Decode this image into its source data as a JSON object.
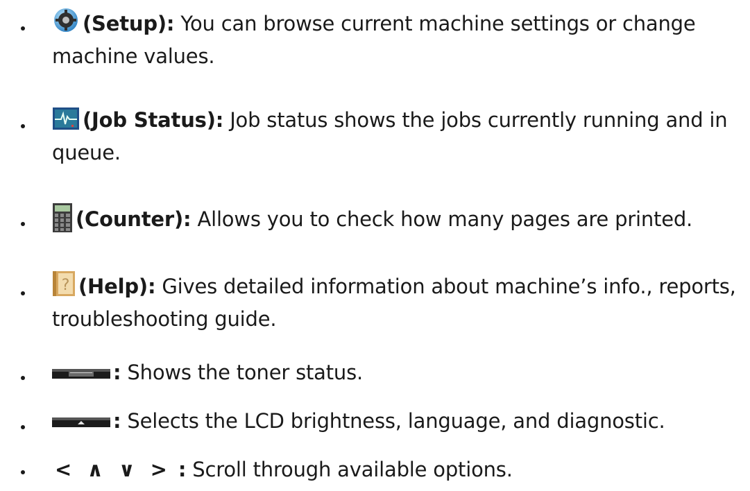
{
  "items": [
    {
      "icon": "setup-gear-icon",
      "label": "(Setup):",
      "text": " You can browse current machine settings or change machine values."
    },
    {
      "icon": "job-status-monitor-icon",
      "label": "(Job Status):",
      "text": " Job status shows the jobs currently running and in queue."
    },
    {
      "icon": "counter-calculator-icon",
      "label": "(Counter):",
      "text": " Allows you to check how many pages are printed."
    },
    {
      "icon": "help-question-icon",
      "label": "(Help):",
      "text": " Gives detailed information about machine’s info., reports, troubleshooting guide."
    },
    {
      "icon": "toner-button-icon",
      "label": ":",
      "text": " Shows the toner status."
    },
    {
      "icon": "menu-eject-button-icon",
      "label": ":",
      "text": " Selects the LCD brightness, language, and diagnostic."
    },
    {
      "icon": "arrow-keys-icon",
      "arrows": "< ∧ ∨ >",
      "label": " :",
      "text": " Scroll through available options."
    }
  ]
}
